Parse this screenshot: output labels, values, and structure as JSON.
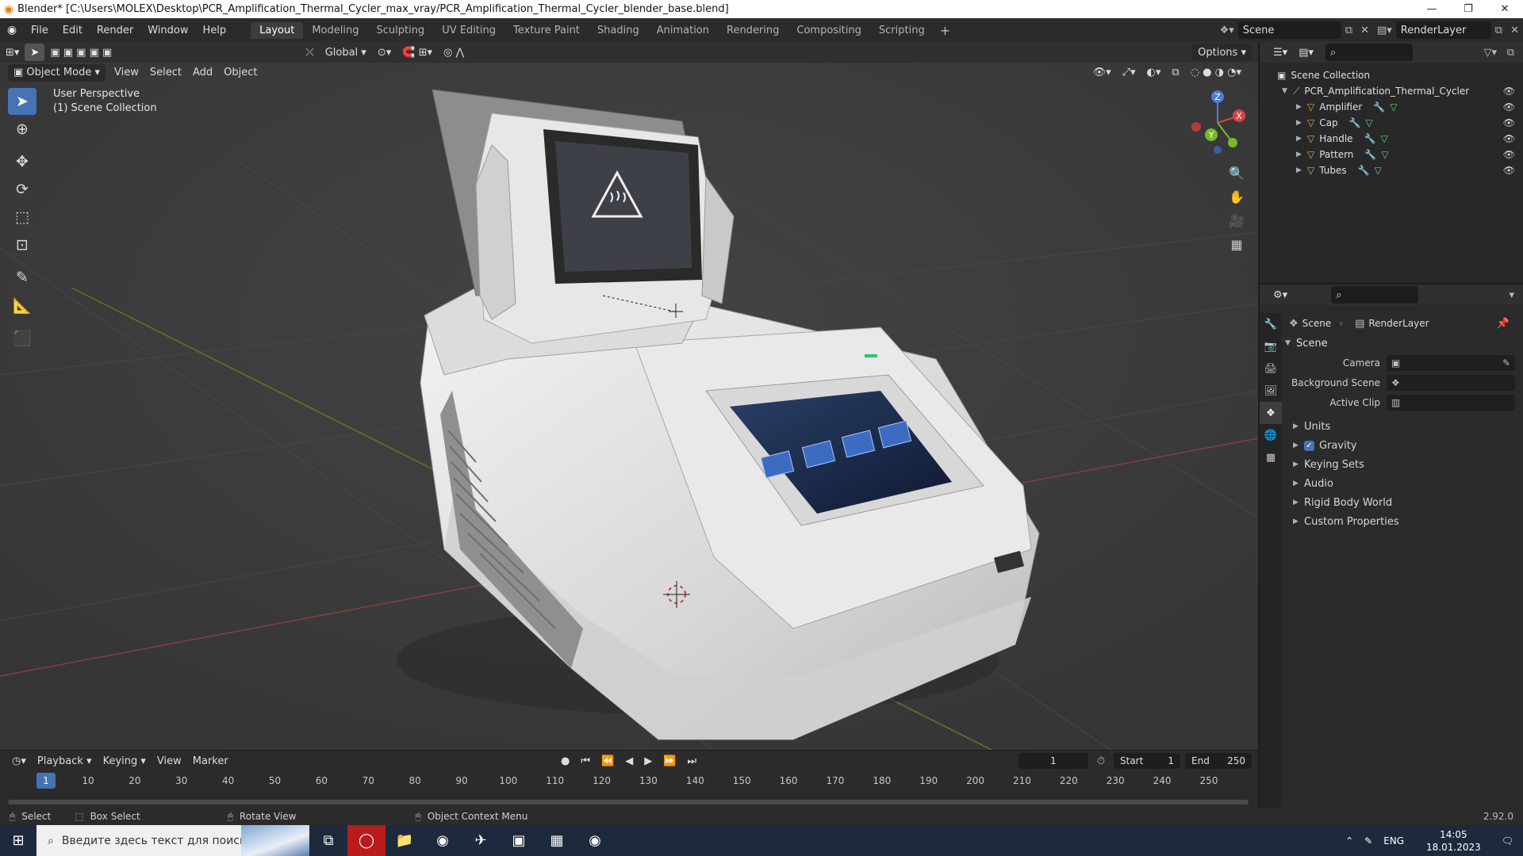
{
  "window": {
    "title": "Blender* [C:\\Users\\MOLEX\\Desktop\\PCR_Amplification_Thermal_Cycler_max_vray/PCR_Amplification_Thermal_Cycler_blender_base.blend]"
  },
  "menu": [
    "File",
    "Edit",
    "Render",
    "Window",
    "Help"
  ],
  "workspaces": {
    "tabs": [
      "Layout",
      "Modeling",
      "Sculpting",
      "UV Editing",
      "Texture Paint",
      "Shading",
      "Animation",
      "Rendering",
      "Compositing",
      "Scripting"
    ],
    "active": "Layout"
  },
  "top_right": {
    "scene": "Scene",
    "view_layer": "RenderLayer"
  },
  "viewport": {
    "transform_orientation": "Global",
    "options_label": "Options",
    "mode": "Object Mode",
    "menus": [
      "View",
      "Select",
      "Add",
      "Object"
    ],
    "info_line1": "User Perspective",
    "info_line2": "(1) Scene Collection"
  },
  "gizmo": {
    "x_label": "X",
    "y_label": "Y",
    "z_label": "Z"
  },
  "outliner": {
    "root": "Scene Collection",
    "collection": "PCR_Amplification_Thermal_Cycler",
    "objects": [
      "Amplifier",
      "Cap",
      "Handle",
      "Pattern",
      "Tubes"
    ]
  },
  "properties": {
    "crumb_scene": "Scene",
    "crumb_layer": "RenderLayer",
    "panel": "Scene",
    "fields": [
      {
        "label": "Camera",
        "value": ""
      },
      {
        "label": "Background Scene",
        "value": ""
      },
      {
        "label": "Active Clip",
        "value": ""
      }
    ],
    "subpanels": [
      "Units",
      "Gravity",
      "Keying Sets",
      "Audio",
      "Rigid Body World",
      "Custom Properties"
    ]
  },
  "timeline": {
    "menus": [
      "Playback",
      "Keying",
      "View",
      "Marker"
    ],
    "current_frame": "1",
    "start_label": "Start",
    "start": "1",
    "end_label": "End",
    "end": "250",
    "ticks": [
      "1",
      "10",
      "20",
      "30",
      "40",
      "50",
      "60",
      "70",
      "80",
      "90",
      "100",
      "110",
      "120",
      "130",
      "140",
      "150",
      "160",
      "170",
      "180",
      "190",
      "200",
      "210",
      "220",
      "230",
      "240",
      "250"
    ]
  },
  "status": {
    "select": "Select",
    "box_select": "Box Select",
    "rotate": "Rotate View",
    "context": "Object Context Menu",
    "version": "2.92.0"
  },
  "taskbar": {
    "search_placeholder": "Введите здесь текст для поиска",
    "lang": "ENG",
    "time": "14:05",
    "date": "18.01.2023"
  }
}
